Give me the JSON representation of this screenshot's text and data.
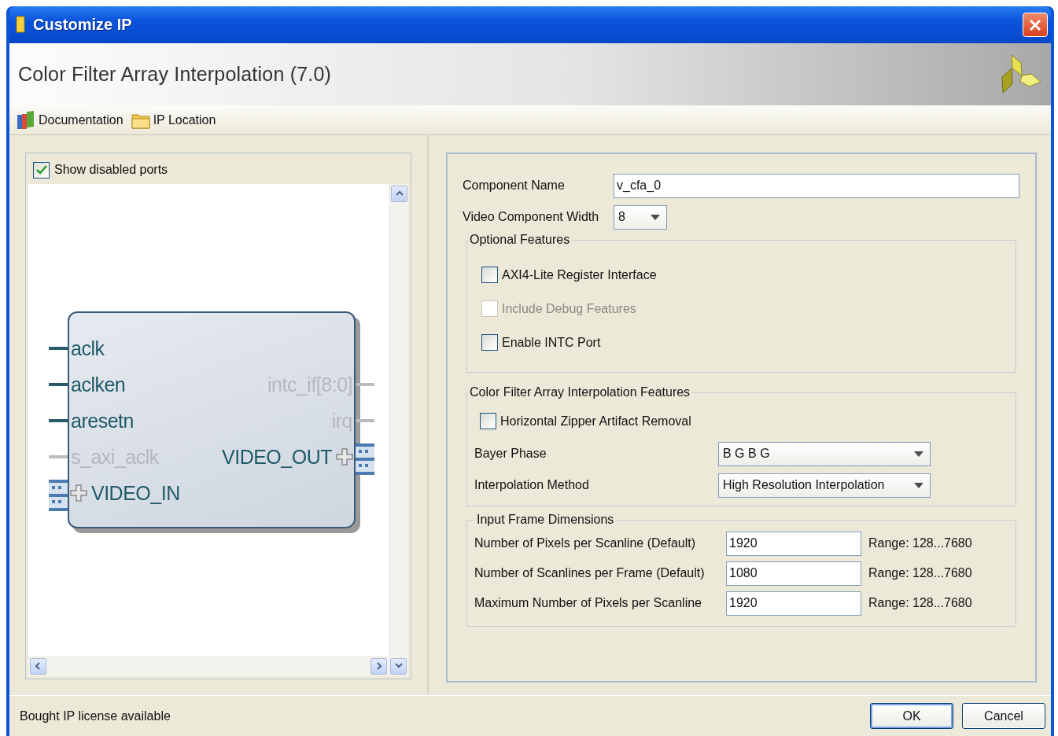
{
  "window": {
    "title": "Customize IP"
  },
  "header": {
    "title": "Color Filter Array Interpolation (7.0)"
  },
  "toolbar": [
    {
      "label": "Documentation",
      "kind": "books"
    },
    {
      "label": "IP Location",
      "kind": "folder"
    }
  ],
  "symbol_panel": {
    "show_disabled_ports": {
      "label": "Show disabled ports",
      "checked": true
    },
    "left_ports": [
      {
        "name": "aclk",
        "kind": "wire",
        "enabled": true
      },
      {
        "name": "aclken",
        "kind": "wire",
        "enabled": true
      },
      {
        "name": "aresetn",
        "kind": "wire",
        "enabled": true
      },
      {
        "name": "s_axi_aclk",
        "kind": "wire",
        "enabled": false
      },
      {
        "name": "VIDEO_IN",
        "kind": "bus",
        "enabled": true
      }
    ],
    "right_ports": [
      {
        "name": "intc_if[8:0]",
        "kind": "wire",
        "enabled": false
      },
      {
        "name": "irq",
        "kind": "wire",
        "enabled": false
      },
      {
        "name": "VIDEO_OUT",
        "kind": "bus",
        "enabled": true
      }
    ]
  },
  "component_name": {
    "label": "Component Name",
    "value": "v_cfa_0"
  },
  "video_component_width": {
    "label": "Video Component Width",
    "value": "8"
  },
  "optional_features": {
    "title": "Optional Features",
    "options": [
      {
        "label": "AXI4-Lite Register Interface",
        "checked": false,
        "disabled": false
      },
      {
        "label": "Include Debug Features",
        "checked": false,
        "disabled": true
      },
      {
        "label": "Enable INTC Port",
        "checked": false,
        "disabled": false
      }
    ]
  },
  "cfa_features": {
    "title": "Color Filter Array Interpolation Features",
    "options": [
      {
        "label": "Horizontal Zipper Artifact Removal",
        "checked": false,
        "disabled": false
      }
    ],
    "selects": [
      {
        "label": "Bayer Phase",
        "value": "B G B G"
      },
      {
        "label": "Interpolation Method",
        "value": "High Resolution Interpolation"
      }
    ]
  },
  "frame_dimensions": {
    "title": "Input Frame Dimensions",
    "rows": [
      {
        "label": "Number of Pixels per Scanline (Default)",
        "value": "1920",
        "range": "Range: 128...7680"
      },
      {
        "label": "Number of Scanlines per Frame (Default)",
        "value": "1080",
        "range": "Range: 128...7680"
      },
      {
        "label": "Maximum Number of Pixels per Scanline",
        "value": "1920",
        "range": "Range: 128...7680"
      }
    ]
  },
  "status": "Bought IP license available",
  "buttons": [
    {
      "label": "OK",
      "default": true
    },
    {
      "label": "Cancel",
      "default": false
    }
  ]
}
